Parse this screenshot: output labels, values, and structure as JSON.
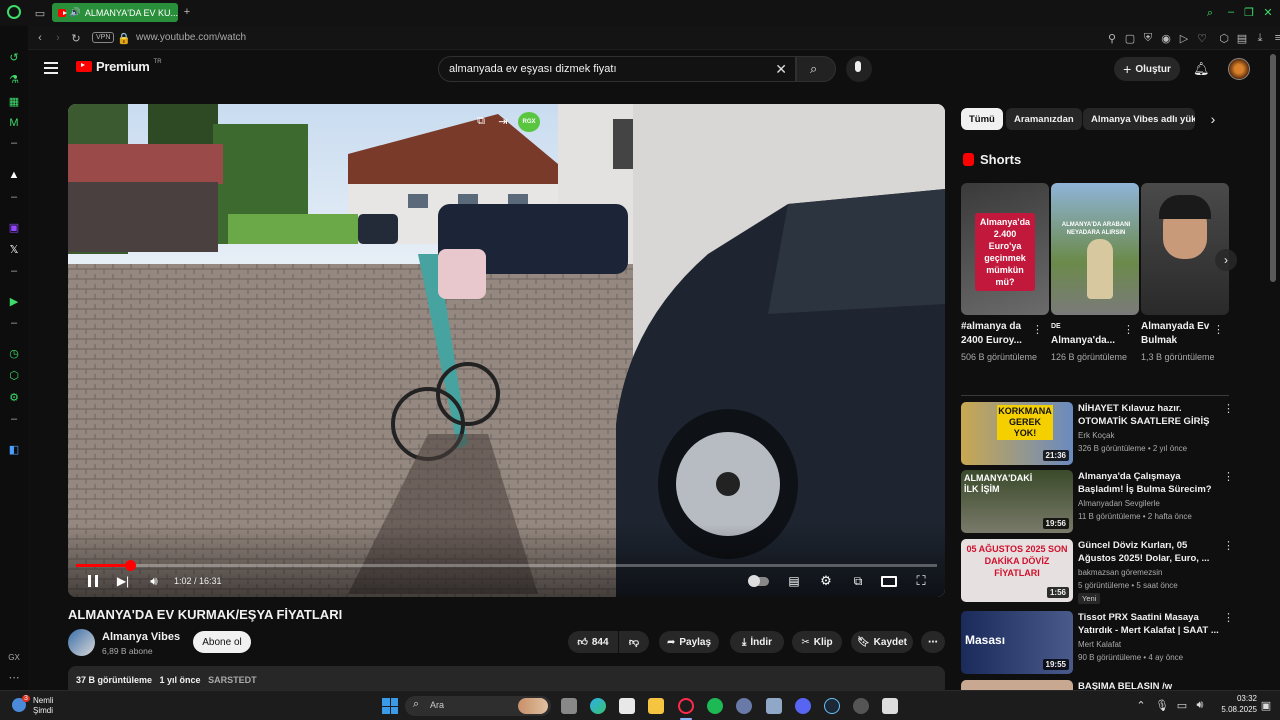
{
  "browser": {
    "tab_title": "ALMANYA'DA EV KU...",
    "url": "www.youtube.com/watch",
    "vpn_label": "VPN"
  },
  "youtube": {
    "logo_text": "Premium",
    "logo_badge": "TR",
    "search_value": "almanyada ev eşyası dizmek fiyatı",
    "create_label": "Oluştur",
    "video": {
      "time": "1:02 / 16:31",
      "progress": 0.063,
      "title": "ALMANYA'DA EV KURMAK/EŞYA FİYATLARI",
      "channel": "Almanya Vibes",
      "subscribers": "6,89 B abone",
      "subscribe_label": "Abone ol",
      "likes": "844",
      "share_label": "Paylaş",
      "download_label": "İndir",
      "clip_label": "Klip",
      "save_label": "Kaydet",
      "desc_views": "37 B görüntüleme",
      "desc_date": "1 yıl önce",
      "desc_tag": "SARSTEDT",
      "overlay_badge": "RGX"
    },
    "chips": [
      "Tümü",
      "Aramanızdan",
      "Almanya Vibes adlı yükle"
    ],
    "shorts_heading": "Shorts",
    "shorts": [
      {
        "title": "#almanya da 2400 Euroy...",
        "views": "506 B görüntüleme",
        "thumb_text": "Almanya'da 2.400 Euro'ya geçinmek mümkün mü?",
        "badge": ""
      },
      {
        "title": "Almanya'da...",
        "views": "126 B görüntüleme",
        "thumb_text": "ALMANYA'DA ARABANI NEYADARA ALIRSIN",
        "badge": "DE"
      },
      {
        "title": "Almanyada Ev Bulmak",
        "views": "1,3 B görüntüleme",
        "thumb_text": "",
        "badge": ""
      }
    ],
    "recommendations": [
      {
        "title": "NİHAYET Kılavuz hazır. OTOMATİK SAATLERE GİRİŞ",
        "channel": "Erk Koçak",
        "meta": "326 B görüntüleme • 2 yıl önce",
        "duration": "21:36",
        "thumb_text": "KORKMANA GEREK YOK!",
        "tag": ""
      },
      {
        "title": "Almanya'da Çalışmaya Başladım! İş Bulma Sürecim?",
        "channel": "Almanyadan Sevgilerle",
        "meta": "11 B görüntüleme • 2 hafta önce",
        "duration": "19:56",
        "thumb_text": "ALMANYA'DAKİ İLK İŞİM",
        "tag": ""
      },
      {
        "title": "Güncel Döviz Kurları, 05 Ağustos 2025! Dolar, Euro, ...",
        "channel": "bakmazsan göremezsin",
        "meta": "5 görüntüleme • 5 saat önce",
        "duration": "1:56",
        "thumb_text": "05 AĞUSTOS 2025 SON DAKİKA DÖVİZ FİYATLARI",
        "tag": "Yeni"
      },
      {
        "title": "Tissot PRX Saatini Masaya Yatırdık - Mert Kalafat | SAAT ...",
        "channel": "Mert Kalafat",
        "meta": "90 B görüntüleme • 4 ay önce",
        "duration": "19:55",
        "thumb_text": "Masası",
        "tag": ""
      },
      {
        "title": "BAŞIMA BELASIN /w",
        "channel": "",
        "meta": "",
        "duration": "",
        "thumb_text": "",
        "tag": ""
      }
    ]
  },
  "taskbar": {
    "weather_temp": "3",
    "weather_label1": "Nemli",
    "weather_label2": "Şimdi",
    "search_label": "Ara",
    "time": "03:32",
    "date": "5.08.2025"
  },
  "colors": {
    "opera_green": "#3ddc6a",
    "yt_red": "#ff0000",
    "bg": "#0f0f0f"
  }
}
